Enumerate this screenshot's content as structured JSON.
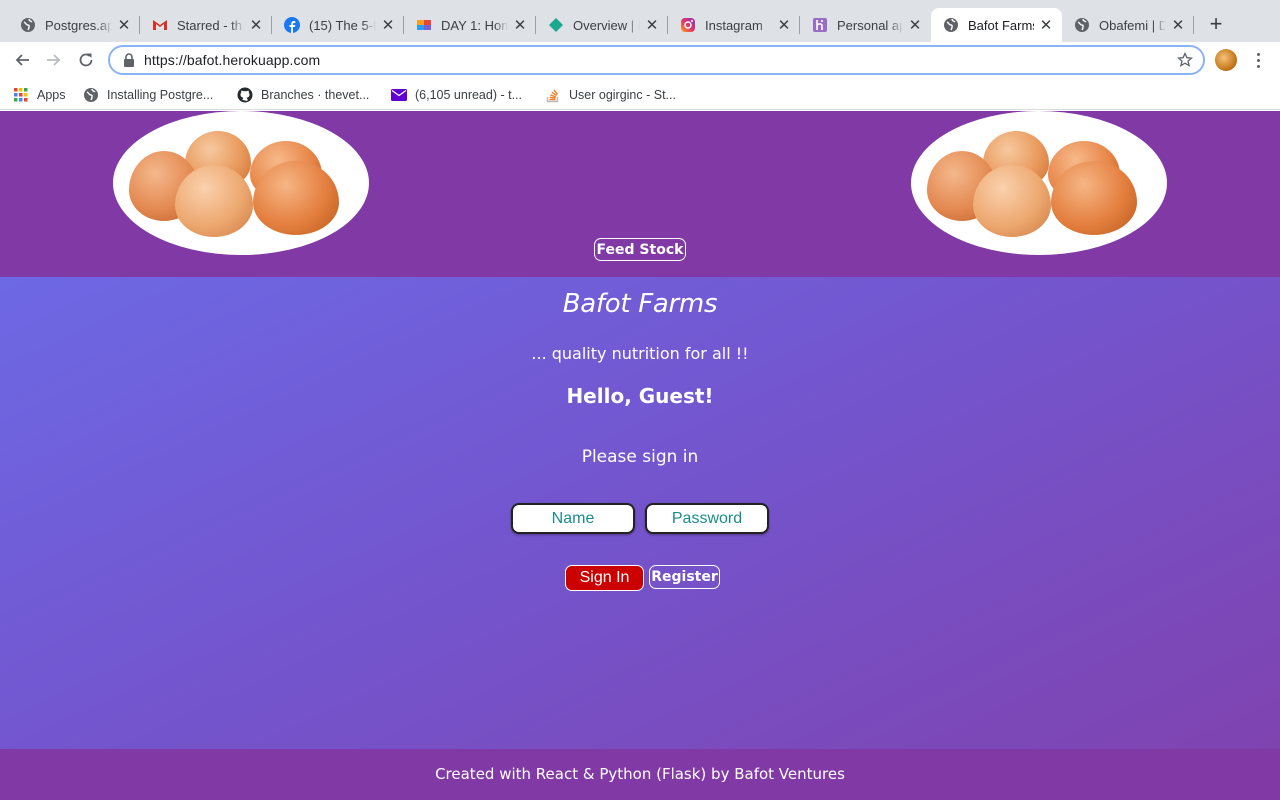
{
  "browser": {
    "tabs": [
      {
        "title": "Postgres.ap",
        "icon": "globe-icon"
      },
      {
        "title": "Starred - th",
        "icon": "gmail-icon"
      },
      {
        "title": "(15) The 5-L",
        "icon": "facebook-icon"
      },
      {
        "title": "DAY 1: Hom",
        "icon": "asana-icon"
      },
      {
        "title": "Overview | I",
        "icon": "diamond-icon"
      },
      {
        "title": "Instagram",
        "icon": "instagram-icon"
      },
      {
        "title": "Personal ap",
        "icon": "heroku-icon"
      },
      {
        "title": "Bafot Farms",
        "icon": "globe-icon",
        "active": true
      },
      {
        "title": "Obafemi | D",
        "icon": "globe-icon"
      }
    ],
    "url": "https://bafot.herokuapp.com",
    "bookmarks": [
      {
        "label": "Apps",
        "icon": "apps-grid-icon"
      },
      {
        "label": "Installing Postgre...",
        "icon": "globe-icon"
      },
      {
        "label": "Branches · thevet...",
        "icon": "github-icon"
      },
      {
        "label": "(6,105 unread) - t...",
        "icon": "mail-icon"
      },
      {
        "label": "User ogirginc - St...",
        "icon": "stackoverflow-icon"
      }
    ]
  },
  "page": {
    "header": {
      "feed_stock_label": "Feed Stock"
    },
    "brand": "Bafot Farms",
    "tagline": "... quality nutrition for all !!",
    "greeting": "Hello, Guest!",
    "prompt": "Please sign in",
    "form": {
      "name_placeholder": "Name",
      "password_placeholder": "Password",
      "sign_in_label": "Sign In",
      "register_label": "Register"
    },
    "footer": "Created with React & Python (Flask) by Bafot Ventures"
  },
  "colors": {
    "header_bg": "#8139a6",
    "gradient_start": "#6d68e4",
    "gradient_end": "#7f43b0",
    "sign_in_bg": "#cc0000",
    "field_text": "#1a8c8c"
  }
}
